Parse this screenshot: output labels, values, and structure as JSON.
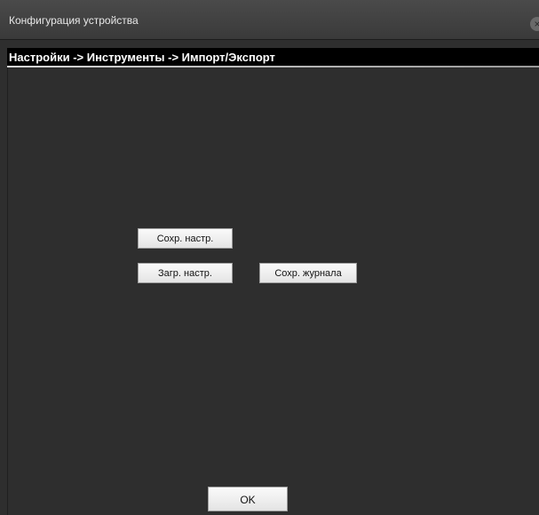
{
  "window": {
    "title": "Конфигурация устройства",
    "close_icon": "close-icon"
  },
  "breadcrumb": {
    "text": "Настройки -> Инструменты -> Импорт/Экспорт"
  },
  "actions": {
    "save_config_label": "Сохр. настр.",
    "load_config_label": "Загр. настр.",
    "save_log_label": "Сохр. журнала",
    "ok_label": "OK"
  },
  "colors": {
    "background": "#2e2e2e",
    "breadcrumb_bar": "#000000",
    "button_face": "#f0f0f0"
  }
}
